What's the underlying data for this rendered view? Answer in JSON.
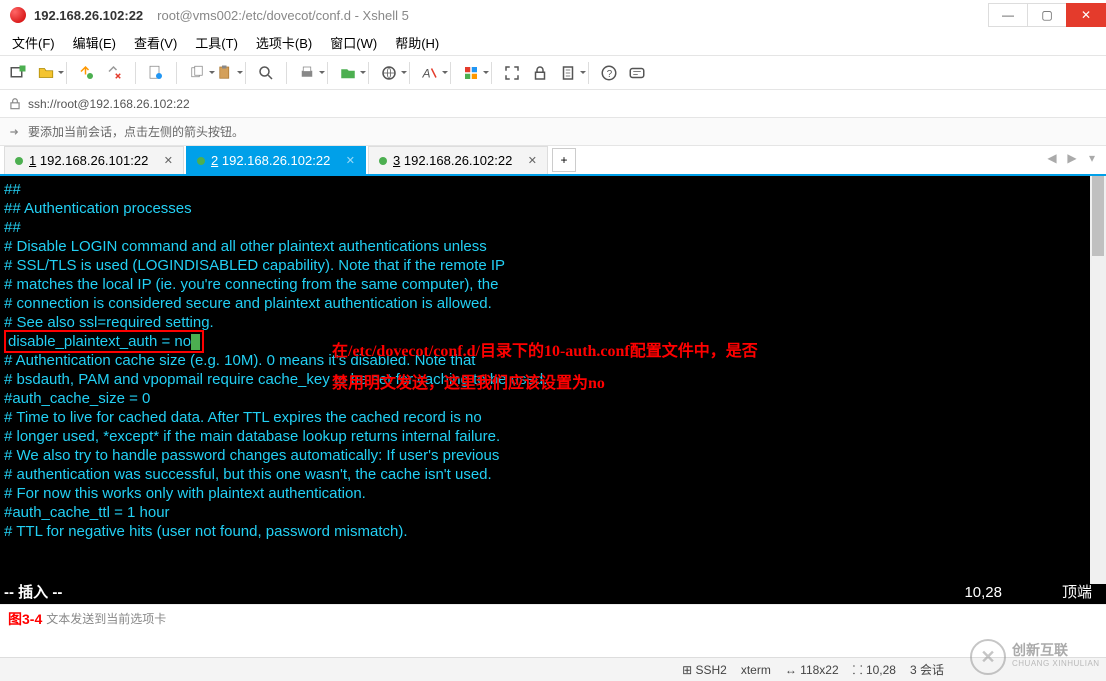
{
  "window": {
    "title_main": "192.168.26.102:22",
    "title_sub": "root@vms002:/etc/dovecot/conf.d - Xshell 5"
  },
  "menu": {
    "file": "文件(F)",
    "edit": "编辑(E)",
    "view": "查看(V)",
    "tools": "工具(T)",
    "tabs": "选项卡(B)",
    "window": "窗口(W)",
    "help": "帮助(H)"
  },
  "address": {
    "url": "ssh://root@192.168.26.102:22"
  },
  "hint": {
    "text": "要添加当前会话，点击左侧的箭头按钮。"
  },
  "tabs": [
    {
      "num": "1",
      "label": "192.168.26.101:22",
      "active": false
    },
    {
      "num": "2",
      "label": "192.168.26.102:22",
      "active": true
    },
    {
      "num": "3",
      "label": "192.168.26.102:22",
      "active": false
    }
  ],
  "terminal": {
    "lines": [
      "##",
      "## Authentication processes",
      "##",
      "",
      "# Disable LOGIN command and all other plaintext authentications unless",
      "# SSL/TLS is used (LOGINDISABLED capability). Note that if the remote IP",
      "# matches the local IP (ie. you're connecting from the same computer), the",
      "# connection is considered secure and plaintext authentication is allowed.",
      "# See also ssl=required setting.",
      "",
      "",
      "# Authentication cache size (e.g. 10M). 0 means it's disabled. Note that",
      "# bsdauth, PAM and vpopmail require cache_key to be set for caching to be used.",
      "#auth_cache_size = 0",
      "# Time to live for cached data. After TTL expires the cached record is no",
      "# longer used, *except* if the main database lookup returns internal failure.",
      "# We also try to handle password changes automatically: If user's previous",
      "# authentication was successful, but this one wasn't, the cache isn't used.",
      "# For now this works only with plaintext authentication.",
      "#auth_cache_ttl = 1 hour",
      "# TTL for negative hits (user not found, password mismatch)."
    ],
    "highlighted": "disable_plaintext_auth = no",
    "mode": "-- 插入 --",
    "pos": "10,28",
    "topright": "顶端"
  },
  "annotation": {
    "line1": "在/etc/dovecot/conf.d/目录下的10-auth.conf配置文件中，是否",
    "line2": "禁用明文发送，这里我们应该设置为no"
  },
  "figure_label": "图3-4",
  "bottom_input_placeholder": "文本发送到当前选项卡",
  "statusbar": {
    "proto": "SSH2",
    "term": "xterm",
    "size": "118x22",
    "pos": "10,28",
    "sessions": "3 会话"
  },
  "watermark": {
    "zh": "创新互联",
    "py": "CHUANG XINHULIAN"
  }
}
